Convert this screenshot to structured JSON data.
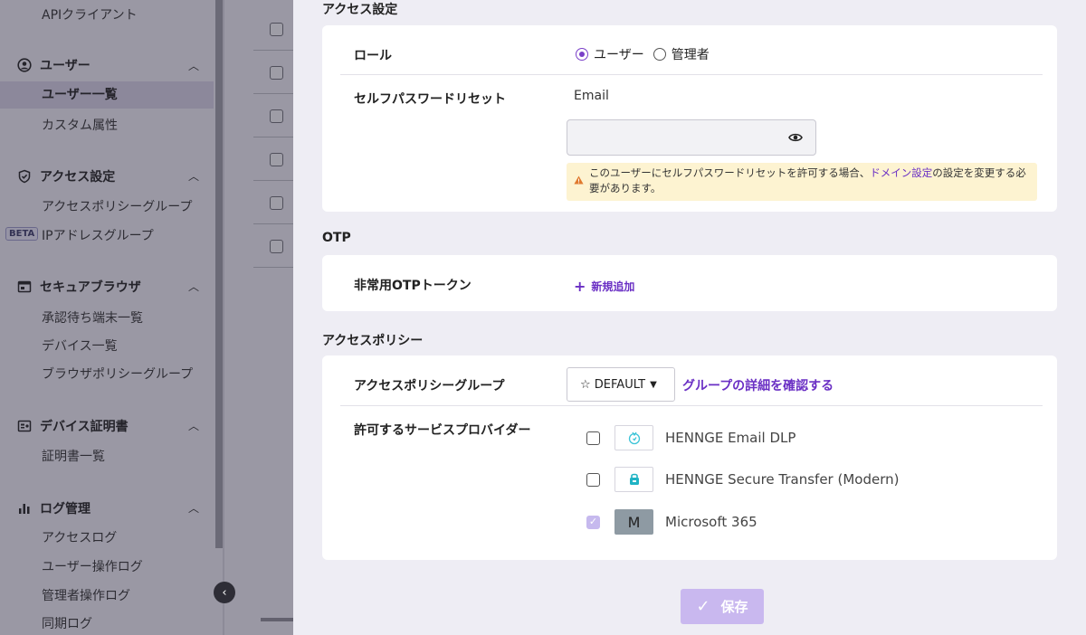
{
  "sidebar": {
    "api_client": "APIクライアント",
    "user_section": "ユーザー",
    "user_list": "ユーザー一覧",
    "custom_attrs": "カスタム属性",
    "access_section": "アクセス設定",
    "access_policy_groups": "アクセスポリシーグループ",
    "beta_badge": "BETA",
    "ip_groups": "IPアドレスグループ",
    "browser_section": "セキュアブラウザ",
    "pending_devices": "承認待ち端末一覧",
    "device_list": "デバイス一覧",
    "browser_policy_groups": "ブラウザポリシーグループ",
    "cert_section": "デバイス証明書",
    "cert_list": "証明書一覧",
    "log_section": "ログ管理",
    "access_log": "アクセスログ",
    "user_ops_log": "ユーザー操作ログ",
    "admin_ops_log": "管理者操作ログ",
    "sync_log": "同期ログ"
  },
  "access_settings": {
    "title": "アクセス設定",
    "role_label": "ロール",
    "role_options": [
      "ユーザー",
      "管理者"
    ],
    "role_selected": "ユーザー",
    "self_reset_label": "セルフパスワードリセット",
    "email_label": "Email",
    "password_value": "",
    "warning_pre": "このユーザーにセルフパスワードリセットを許可する場合、",
    "warning_link": "ドメイン設定",
    "warning_post": "の設定を変更する必要があります。"
  },
  "otp": {
    "title": "OTP",
    "emergency_label": "非常用OTPトークン",
    "add_label": "新規追加"
  },
  "access_policy": {
    "title": "アクセスポリシー",
    "group_label": "アクセスポリシーグループ",
    "group_value": "☆ DEFAULT",
    "group_link": "グループの詳細を確認する",
    "providers_label": "許可するサービスプロバイダー",
    "providers": [
      {
        "name": "HENNGE Email DLP",
        "checked": false
      },
      {
        "name": "HENNGE Secure Transfer (Modern)",
        "checked": false
      },
      {
        "name": "Microsoft 365",
        "checked": true,
        "logo_text": "M"
      }
    ]
  },
  "footer": {
    "save_label": "保存"
  }
}
